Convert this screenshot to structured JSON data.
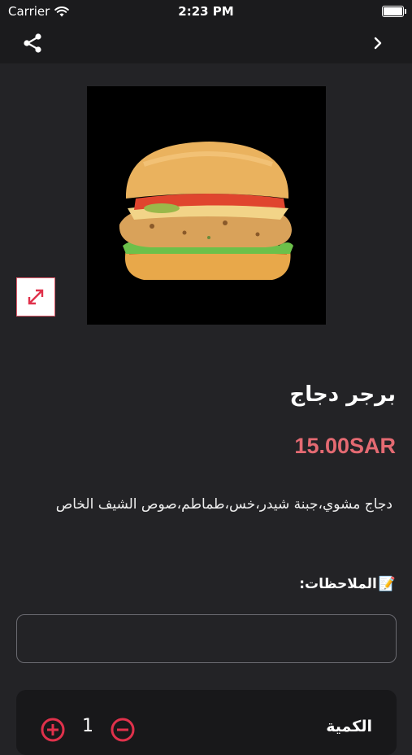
{
  "status_bar": {
    "carrier": "Carrier",
    "time": "2:23 PM"
  },
  "nav": {
    "share_icon": "share-icon",
    "back_icon": "chevron-right-icon"
  },
  "product": {
    "image_icon": "burger-image",
    "name": "برجر دجاج",
    "price": "15.00SAR",
    "description": "دجاج مشوي،جبنة شيدر،خس،طماطم،صوص الشيف الخاص"
  },
  "notes": {
    "emoji": "📝",
    "label": "الملاحظات:",
    "value": ""
  },
  "quantity": {
    "label": "الكمية",
    "value": "1"
  },
  "colors": {
    "background": "#232326",
    "bar": "#1b1b1d",
    "price": "#e46a72",
    "accent": "#e0314b"
  }
}
